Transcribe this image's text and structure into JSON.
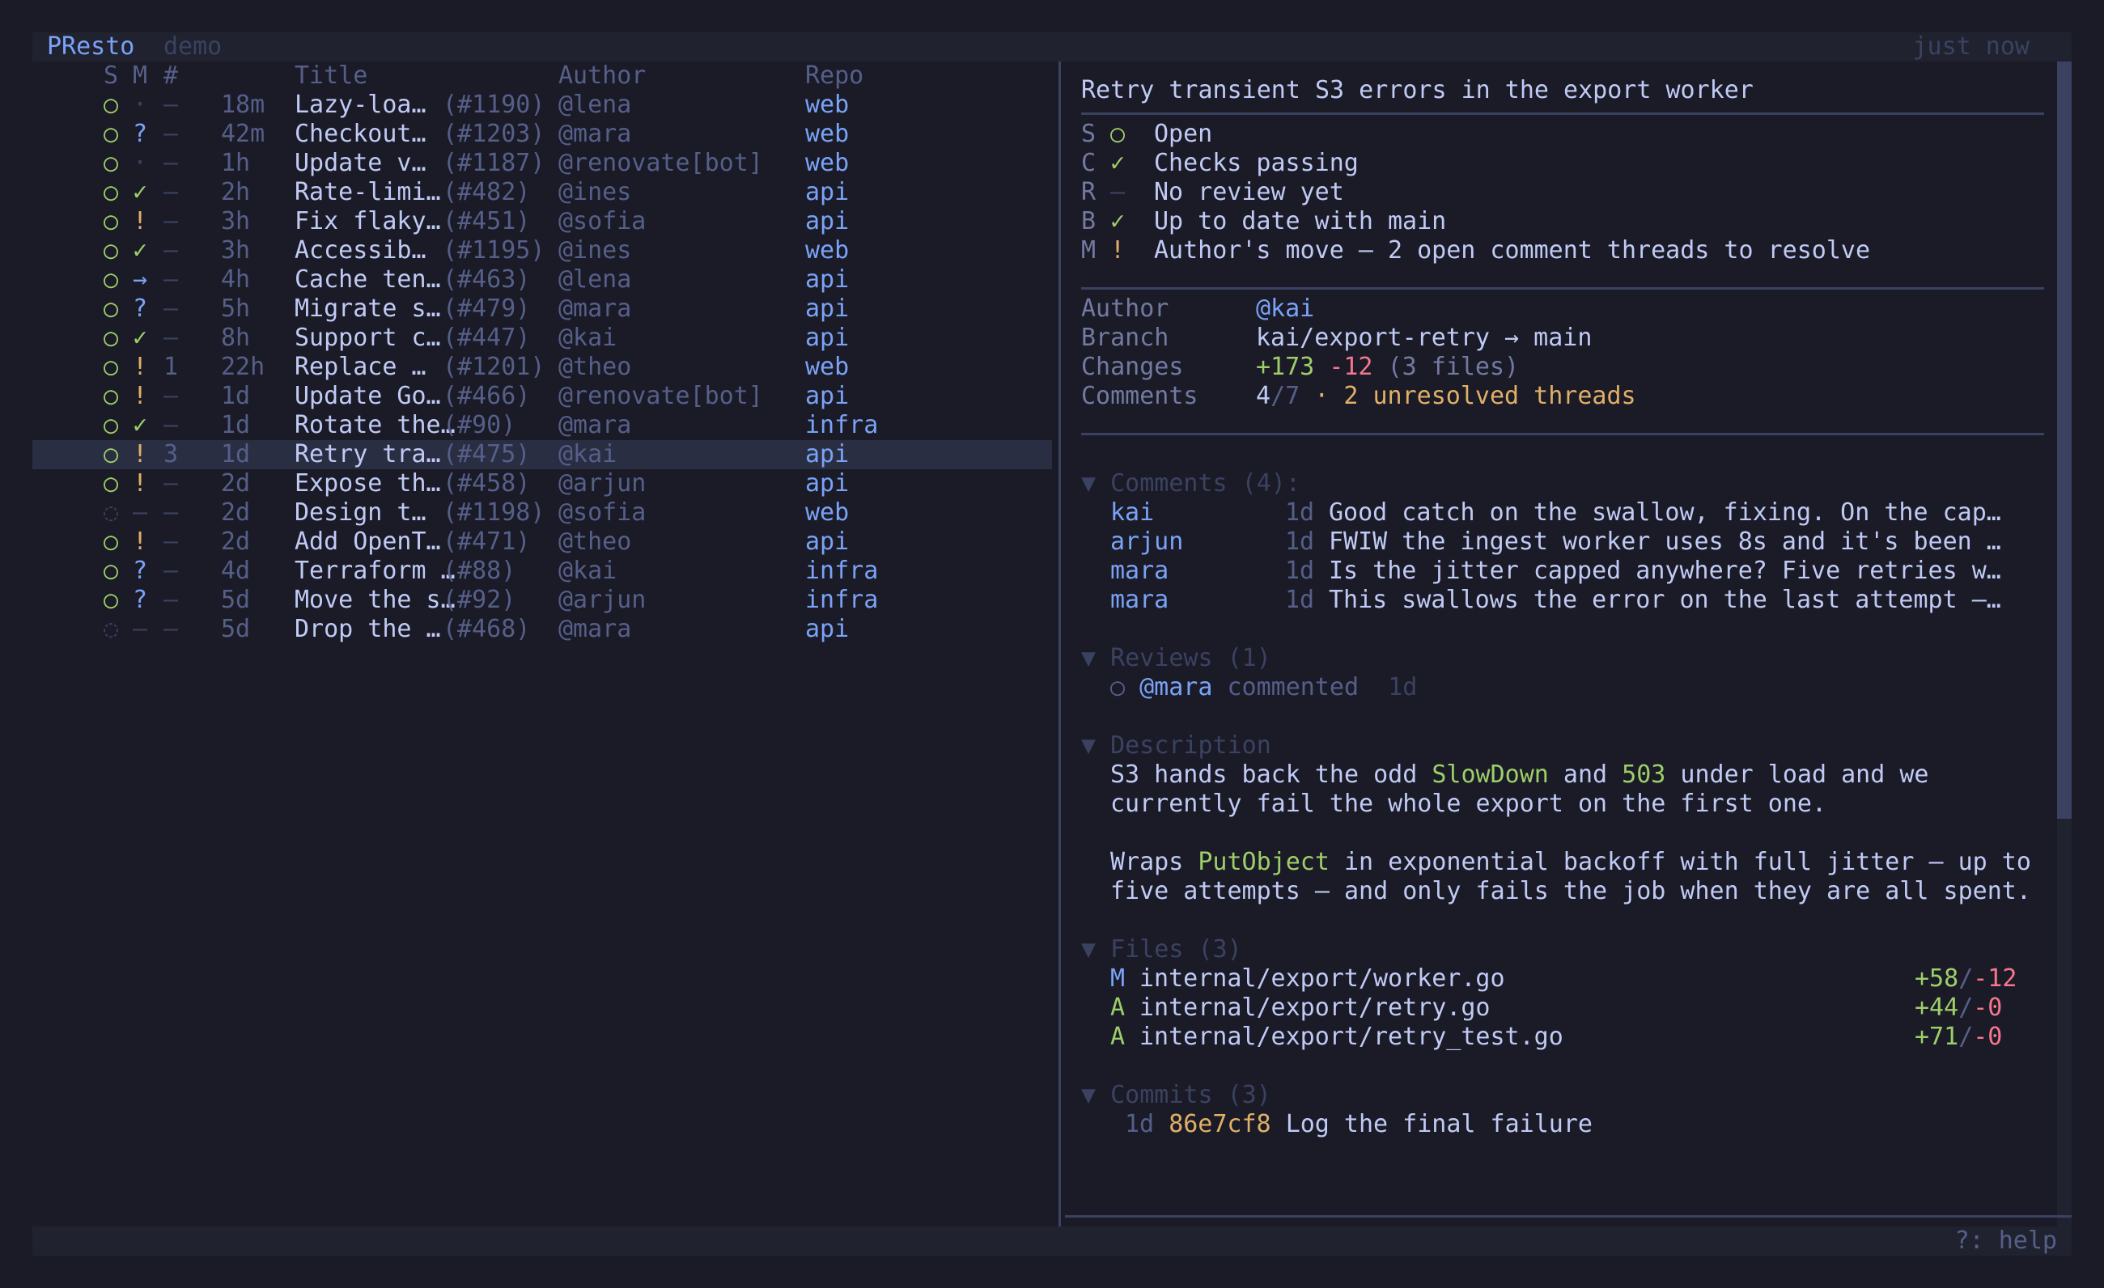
{
  "app": {
    "name": "PResto",
    "mode": "demo",
    "updated": "just now",
    "help": "?: help"
  },
  "list": {
    "headers": {
      "s": "S",
      "m": "M",
      "num": "#",
      "title": "Title",
      "author": "Author",
      "repo": "Repo"
    },
    "rows": [
      {
        "s": "○",
        "c": "·",
        "m": "–",
        "age": "18m",
        "title": "Lazy-loa…",
        "num": "(#1190)",
        "author": "@lena",
        "repo": "web"
      },
      {
        "s": "○",
        "c": "?",
        "m": "–",
        "age": "42m",
        "title": "Checkout…",
        "num": "(#1203)",
        "author": "@mara",
        "repo": "web"
      },
      {
        "s": "○",
        "c": "·",
        "m": "–",
        "age": "1h",
        "title": "Update v…",
        "num": "(#1187)",
        "author": "@renovate[bot]",
        "repo": "web"
      },
      {
        "s": "○",
        "c": "✓",
        "m": "–",
        "age": "2h",
        "title": "Rate-limi…",
        "num": "(#482)",
        "author": "@ines",
        "repo": "api"
      },
      {
        "s": "○",
        "c": "!",
        "m": "–",
        "age": "3h",
        "title": "Fix flaky…",
        "num": "(#451)",
        "author": "@sofia",
        "repo": "api"
      },
      {
        "s": "○",
        "c": "✓",
        "m": "–",
        "age": "3h",
        "title": "Accessib…",
        "num": "(#1195)",
        "author": "@ines",
        "repo": "web"
      },
      {
        "s": "○",
        "c": "→",
        "m": "–",
        "age": "4h",
        "title": "Cache ten…",
        "num": "(#463)",
        "author": "@lena",
        "repo": "api"
      },
      {
        "s": "○",
        "c": "?",
        "m": "–",
        "age": "5h",
        "title": "Migrate s…",
        "num": "(#479)",
        "author": "@mara",
        "repo": "api"
      },
      {
        "s": "○",
        "c": "✓",
        "m": "–",
        "age": "8h",
        "title": "Support c…",
        "num": "(#447)",
        "author": "@kai",
        "repo": "api"
      },
      {
        "s": "○",
        "c": "!",
        "m": "1",
        "age": "22h",
        "title": "Replace …",
        "num": "(#1201)",
        "author": "@theo",
        "repo": "web"
      },
      {
        "s": "○",
        "c": "!",
        "m": "–",
        "age": "1d",
        "title": "Update Go…",
        "num": "(#466)",
        "author": "@renovate[bot]",
        "repo": "api"
      },
      {
        "s": "○",
        "c": "✓",
        "m": "–",
        "age": "1d",
        "title": "Rotate the…",
        "num": "(#90)",
        "author": "@mara",
        "repo": "infra"
      },
      {
        "s": "○",
        "c": "!",
        "m": "3",
        "age": "1d",
        "title": "Retry tra…",
        "num": "(#475)",
        "author": "@kai",
        "repo": "api"
      },
      {
        "s": "○",
        "c": "!",
        "m": "–",
        "age": "2d",
        "title": "Expose th…",
        "num": "(#458)",
        "author": "@arjun",
        "repo": "api"
      },
      {
        "s": "◌",
        "c": "–",
        "m": "–",
        "age": "2d",
        "title": "Design t…",
        "num": "(#1198)",
        "author": "@sofia",
        "repo": "web"
      },
      {
        "s": "○",
        "c": "!",
        "m": "–",
        "age": "2d",
        "title": "Add OpenT…",
        "num": "(#471)",
        "author": "@theo",
        "repo": "api"
      },
      {
        "s": "○",
        "c": "?",
        "m": "–",
        "age": "4d",
        "title": "Terraform …",
        "num": "(#88)",
        "author": "@kai",
        "repo": "infra"
      },
      {
        "s": "○",
        "c": "?",
        "m": "–",
        "age": "5d",
        "title": "Move the s…",
        "num": "(#92)",
        "author": "@arjun",
        "repo": "infra"
      },
      {
        "s": "◌",
        "c": "–",
        "m": "–",
        "age": "5d",
        "title": "Drop the …",
        "num": "(#468)",
        "author": "@mara",
        "repo": "api"
      }
    ]
  },
  "detail": {
    "title": "Retry transient S3 errors in the export worker",
    "status": [
      {
        "key": "S",
        "icon": "○",
        "text": "Open"
      },
      {
        "key": "C",
        "icon": "✓",
        "text": "Checks passing"
      },
      {
        "key": "R",
        "icon": "–",
        "text": "No review yet"
      },
      {
        "key": "B",
        "icon": "✓",
        "text": "Up to date with main"
      },
      {
        "key": "M",
        "icon": "!",
        "text": "Author's move – 2 open comment threads to resolve"
      }
    ],
    "meta": {
      "author_label": "Author",
      "author": "@kai",
      "branch_label": "Branch",
      "branch": "kai/export-retry → main",
      "changes_label": "Changes",
      "additions": "+173",
      "deletions": "-12",
      "files": "(3 files)",
      "comments_label": "Comments",
      "comments_resolved": "4",
      "comments_total": "/7",
      "unresolved": "· 2 unresolved threads"
    },
    "comments": {
      "header": "▼ Comments (4):",
      "items": [
        {
          "author": "kai",
          "age": "1d",
          "text": "Good catch on the swallow, fixing. On the cap…"
        },
        {
          "author": "arjun",
          "age": "1d",
          "text": "FWIW the ingest worker uses 8s and it's been …"
        },
        {
          "author": "mara",
          "age": "1d",
          "text": "Is the jitter capped anywhere? Five retries w…"
        },
        {
          "author": "mara",
          "age": "1d",
          "text": "This swallows the error on the last attempt –…"
        }
      ]
    },
    "reviews": {
      "header": "▼ Reviews (1)",
      "icon": "○",
      "author": "@mara",
      "action": "commented",
      "age": "1d"
    },
    "description": {
      "header": "▼ Description",
      "l1a": "S3 hands back the odd ",
      "l1b": "SlowDown",
      "l1c": " and ",
      "l1d": "503",
      "l1e": " under load and we",
      "l2": "currently fail the whole export on the first one.",
      "l3a": "Wraps ",
      "l3b": "PutObject",
      "l3c": " in exponential backoff with full jitter – up to",
      "l4": "five attempts – and only fails the job when they are all spent."
    },
    "files": {
      "header": "▼ Files (3)",
      "items": [
        {
          "status": "M",
          "path": "internal/export/worker.go",
          "add": "+58",
          "sep": "/",
          "del": "-12"
        },
        {
          "status": "A",
          "path": "internal/export/retry.go",
          "add": "+44",
          "sep": "/",
          "del": "-0"
        },
        {
          "status": "A",
          "path": "internal/export/retry_test.go",
          "add": "+71",
          "sep": "/",
          "del": "-0"
        }
      ]
    },
    "commits": {
      "header": "▼ Commits (3)",
      "items": [
        {
          "age": "1d",
          "sha": "86e7cf8",
          "msg": "Log the final failure"
        }
      ]
    }
  }
}
